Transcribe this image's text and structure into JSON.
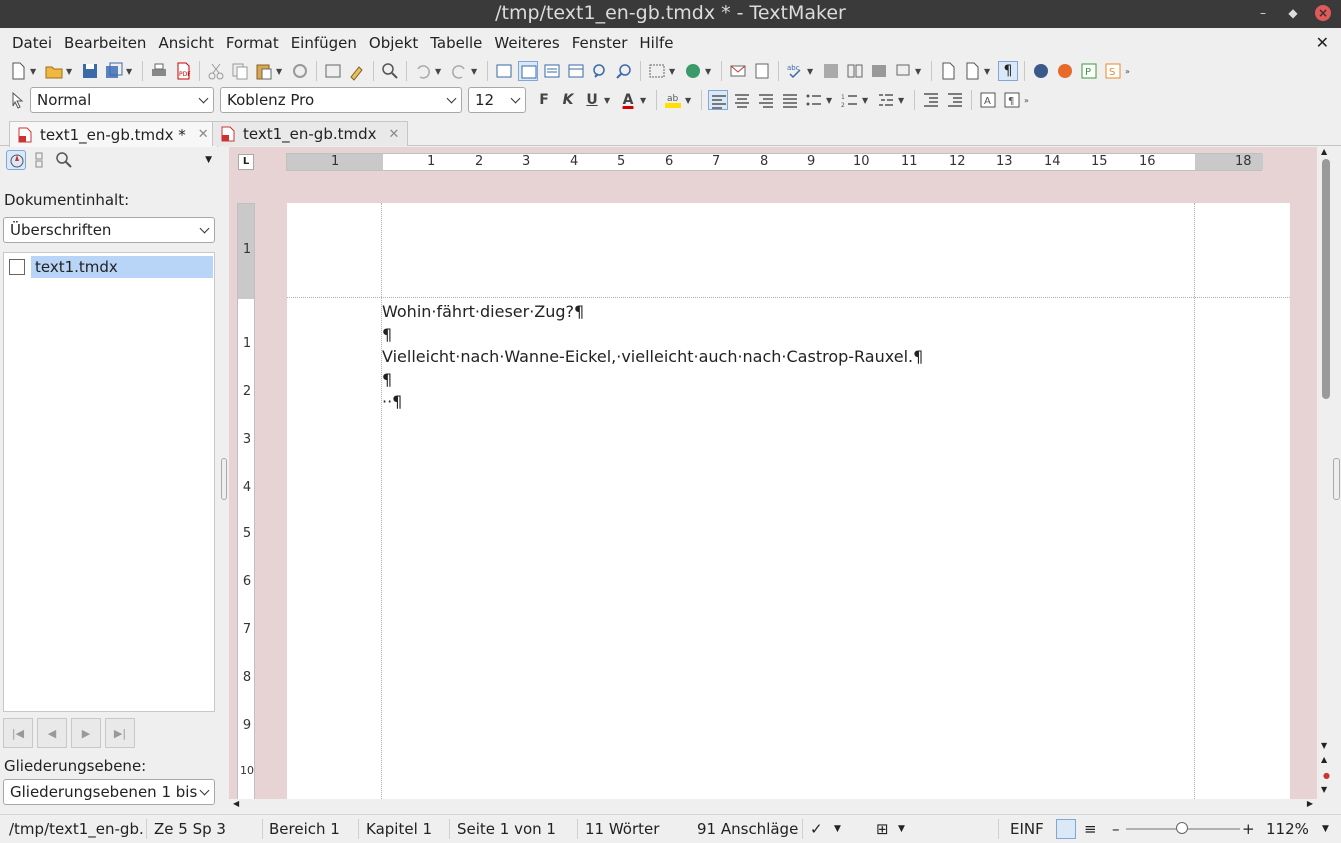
{
  "window": {
    "title": "/tmp/text1_en-gb.tmdx * - TextMaker"
  },
  "menu": {
    "items": [
      "Datei",
      "Bearbeiten",
      "Ansicht",
      "Format",
      "Einfügen",
      "Objekt",
      "Tabelle",
      "Weiteres",
      "Fenster",
      "Hilfe"
    ]
  },
  "format_bar": {
    "style": "Normal",
    "font": "Koblenz Pro",
    "size": "12",
    "bold": "F",
    "italic": "K",
    "underline": "U",
    "font_color": "A",
    "highlight_color": "#ffe000",
    "text_color": "#d00000"
  },
  "tabs": [
    {
      "label": "text1_en-gb.tmdx *",
      "active": true
    },
    {
      "label": "text1_en-gb.tmdx",
      "active": false
    }
  ],
  "sidebar": {
    "content_label": "Dokumentinhalt:",
    "content_select": "Überschriften",
    "tree_item": "text1.tmdx",
    "level_label": "Gliederungsebene:",
    "level_select": "Gliederungsebenen 1 bis"
  },
  "ruler": {
    "h_numbers": [
      "1",
      "1",
      "2",
      "3",
      "4",
      "5",
      "6",
      "7",
      "8",
      "9",
      "10",
      "11",
      "12",
      "13",
      "14",
      "15",
      "16",
      "18"
    ],
    "v_numbers": [
      "1",
      "1",
      "2",
      "3",
      "4",
      "5",
      "6",
      "7",
      "8",
      "9",
      "10"
    ]
  },
  "document": {
    "lines": [
      "Wohin·fährt·dieser·Zug?¶",
      "¶",
      "Vielleicht·nach·Wanne-Eickel,·vielleicht·auch·nach·Castrop-Rauxel.¶",
      "¶",
      "··¶"
    ]
  },
  "status": {
    "path": "/tmp/text1_en-gb.",
    "position": "Ze 5 Sp 3",
    "section": "Bereich 1",
    "chapter": "Kapitel 1",
    "page": "Seite 1 von 1",
    "words": "11 Wörter",
    "chars": "91 Anschläge",
    "mode": "EINF",
    "zoom": "112%"
  },
  "colors": {
    "titlebar": "#3a3a3a",
    "doc_background": "#e7d2d4",
    "selection": "#b8d4f6",
    "close_button": "#e05a5a"
  }
}
